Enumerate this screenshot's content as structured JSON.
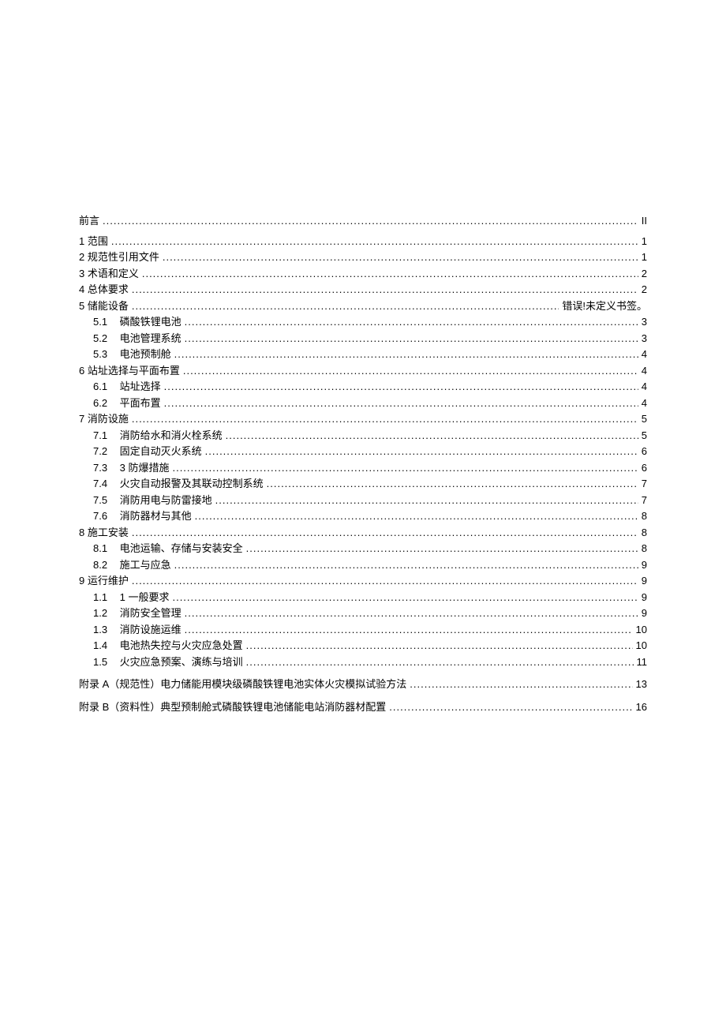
{
  "toc": {
    "entries": [
      {
        "level": 1,
        "label": "前言",
        "page": "II",
        "class": "first"
      },
      {
        "level": 1,
        "label": "1 范围",
        "page": "1"
      },
      {
        "level": 1,
        "label": "2 规范性引用文件",
        "page": "1"
      },
      {
        "level": 1,
        "label": "3 术语和定义",
        "page": "2"
      },
      {
        "level": 1,
        "label": "4 总体要求",
        "page": "2"
      },
      {
        "level": 1,
        "label": "5 储能设备",
        "page": "错误!未定义书签。"
      },
      {
        "level": 2,
        "num": "5.1",
        "label": "磷酸铁锂电池",
        "page": "3"
      },
      {
        "level": 2,
        "num": "5.2",
        "label": "电池管理系统",
        "page": "3"
      },
      {
        "level": 2,
        "num": "5.3",
        "label": "电池预制舱",
        "page": "4"
      },
      {
        "level": 1,
        "label": "6 站址选择与平面布置",
        "page": "4"
      },
      {
        "level": 2,
        "num": "6.1",
        "label": "站址选择",
        "page": "4"
      },
      {
        "level": 2,
        "num": "6.2",
        "label": "平面布置",
        "page": "4"
      },
      {
        "level": 1,
        "label": "7 消防设施",
        "page": "5"
      },
      {
        "level": 2,
        "num": "7.1",
        "label": "消防给水和消火栓系统",
        "page": "5"
      },
      {
        "level": 2,
        "num": "7.2",
        "label": "固定自动灭火系统",
        "page": "6"
      },
      {
        "level": 2,
        "num": "7.3",
        "label": "3 防爆措施",
        "page": "6"
      },
      {
        "level": 2,
        "num": "7.4",
        "label": "火灾自动报警及其联动控制系统",
        "page": "7"
      },
      {
        "level": 2,
        "num": "7.5",
        "label": "消防用电与防雷接地",
        "page": "7"
      },
      {
        "level": 2,
        "num": "7.6",
        "label": "消防器材与其他",
        "page": "8"
      },
      {
        "level": 1,
        "label": "8 施工安装",
        "page": "8"
      },
      {
        "level": 2,
        "num": "8.1",
        "label": "电池运输、存储与安装安全",
        "page": "8"
      },
      {
        "level": 2,
        "num": "8.2",
        "label": "施工与应急",
        "page": "9"
      },
      {
        "level": 1,
        "label": "9 运行维护",
        "page": "9"
      },
      {
        "level": 2,
        "num": "1.1",
        "label": "1 一般要求",
        "page": "9"
      },
      {
        "level": 2,
        "num": "1.2",
        "label": "消防安全管理",
        "page": "9"
      },
      {
        "level": 2,
        "num": "1.3",
        "label": "消防设施运维",
        "page": "10"
      },
      {
        "level": 2,
        "num": "1.4",
        "label": "电池热失控与火灾应急处置",
        "page": "10"
      },
      {
        "level": 2,
        "num": "1.5",
        "label": "火灾应急预案、演练与培训",
        "page": "11"
      },
      {
        "level": 1,
        "label": "附录 A（规范性）电力储能用模块级磷酸铁锂电池实体火灾模拟试验方法",
        "page": "13",
        "class": "appendix"
      },
      {
        "level": 1,
        "label": "附录 B（资料性）典型预制舱式磷酸铁锂电池储能电站消防器材配置",
        "page": "16",
        "class": "appendix"
      }
    ]
  }
}
